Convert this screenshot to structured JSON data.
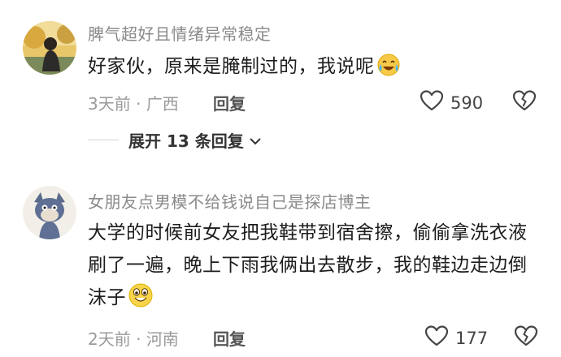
{
  "comments": [
    {
      "username": "脾气超好且情绪异常稳定",
      "text": "好家伙，原来是腌制过的，我说呢",
      "time": "3天前",
      "separator": "·",
      "location": "广西",
      "reply_label": "回复",
      "likes": "590",
      "emoji": "crying-laughing-emoji"
    },
    {
      "username": "女朋友点男模不给钱说自己是探店博主",
      "text": "大学的时候前女友把我鞋带到宿舍擦，偷偷拿洗衣液刷了一遍，晚上下雨我俩出去散步，我的鞋边走边倒沫子",
      "time": "2天前",
      "separator": "·",
      "location": "河南",
      "reply_label": "回复",
      "likes": "177",
      "emoji": "grinning-emoji"
    }
  ],
  "expand_replies": {
    "label": "展开 13 条回复"
  },
  "icons": {
    "like": "heart-outline-icon",
    "dislike": "broken-heart-icon",
    "expand": "chevron-down-icon"
  },
  "colors": {
    "meta": "#9a9a9a",
    "username": "#8a8a8a",
    "text": "#1d1d1d"
  }
}
